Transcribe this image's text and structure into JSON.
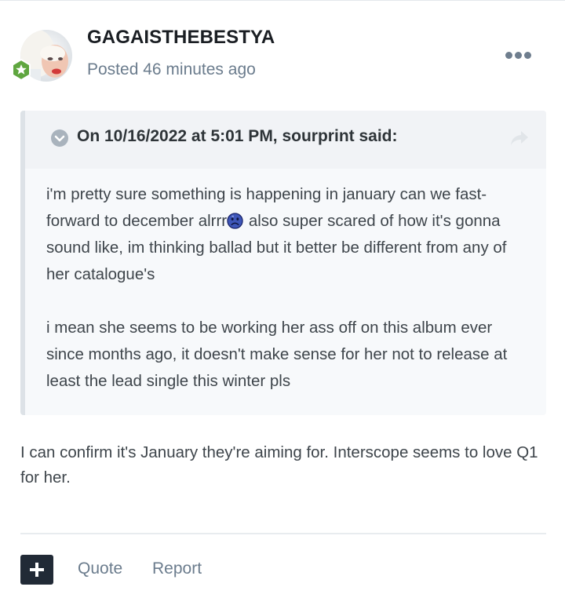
{
  "post": {
    "author": "GAGAISTHEBESTYA",
    "posted": "Posted 46 minutes ago",
    "avatar_icon": "user-avatar-photo",
    "rank_icon": "star-badge-icon",
    "more_icon": "ellipsis-icon"
  },
  "quote": {
    "citation": "On 10/16/2022 at 5:01 PM, sourprint said:",
    "paragraph1_before_emoji": "i'm pretty sure something is happening in january can we fast-forward to december alrrr",
    "emoji_icon": "sad-face-icon",
    "paragraph1_after_emoji": " also super scared of how it's gonna sound like, im thinking ballad but it better be different from any of her catalogue's",
    "paragraph2": "i mean she seems to be working her ass off on this album ever since months ago, it doesn't make sense for her not to release at least the lead single this winter pls"
  },
  "body": {
    "text": "I can confirm it's January they're aiming for. Interscope seems to love Q1 for her."
  },
  "actions": {
    "add_icon": "plus-icon",
    "quote_label": "Quote",
    "report_label": "Report"
  },
  "colors": {
    "author": "#1a1e23",
    "meta": "#6b7c8d",
    "quote_bg": "#f7f9fb",
    "quote_head_bg": "#f1f3f6",
    "add_button": "#212a36",
    "badge_green": "#5fa63f"
  }
}
